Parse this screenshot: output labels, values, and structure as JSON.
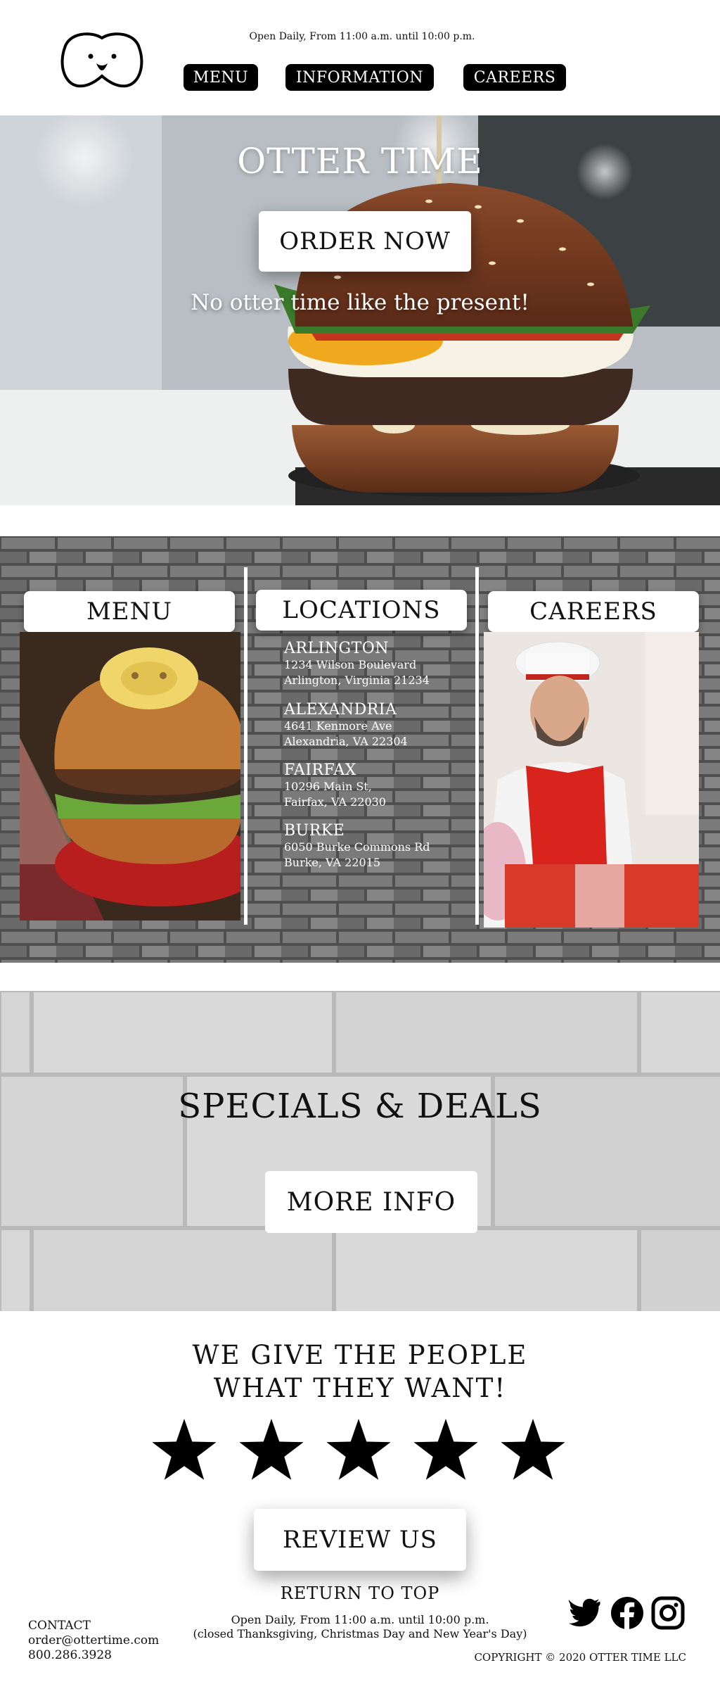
{
  "header": {
    "hours": "Open Daily, From 11:00 a.m. until 10:00 p.m.",
    "nav": {
      "menu": "MENU",
      "information": "INFORMATION",
      "careers": "CAREERS"
    }
  },
  "hero": {
    "title": "OTTER TIME",
    "order_button": "ORDER NOW",
    "tagline": "No otter time like the present!"
  },
  "sections": {
    "menu_label": "MENU",
    "locations_label": "LOCATIONS",
    "careers_label": "CAREERS",
    "locations": [
      {
        "name": "ARLINGTON",
        "line1": "1234 Wilson Boulevard",
        "line2": "Arlington, Virginia 21234"
      },
      {
        "name": "ALEXANDRIA",
        "line1": "4641 Kenmore Ave",
        "line2": "Alexandria, VA 22304"
      },
      {
        "name": "FAIRFAX",
        "line1": "10296 Main St,",
        "line2": "Fairfax, VA 22030"
      },
      {
        "name": "BURKE",
        "line1": "6050 Burke Commons Rd",
        "line2": "Burke, VA 22015"
      }
    ]
  },
  "specials": {
    "title": "SPECIALS & DEALS",
    "button": "MORE INFO"
  },
  "reviews": {
    "title_line1": "WE GIVE THE PEOPLE",
    "title_line2": "WHAT THEY WANT!",
    "rating": 5,
    "max_rating": 5,
    "button": "REVIEW US"
  },
  "footer": {
    "return_top": "RETURN TO TOP",
    "contact_label": "CONTACT",
    "email": "order@ottertime.com",
    "phone": "800.286.3928",
    "hours_line1": "Open Daily, From 11:00 a.m. until 10:00 p.m.",
    "hours_line2": "(closed Thanksgiving, Christmas Day and New Year's Day)",
    "copyright": "COPYRIGHT © 2020 OTTER TIME LLC",
    "social_icons": [
      "twitter-icon",
      "facebook-icon",
      "instagram-icon"
    ]
  },
  "colors": {
    "primary": "#000000",
    "background": "#ffffff",
    "brick": "#6b6b6b",
    "stone": "#d4d4d4"
  }
}
